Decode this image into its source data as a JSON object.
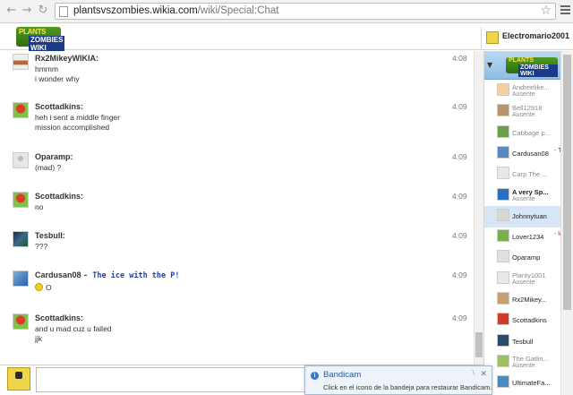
{
  "browser": {
    "url_host": "plantsvszombies.wikia.com",
    "url_path": "/wiki/Special:Chat"
  },
  "header": {
    "logo_line1": "PLANTS",
    "logo_line2": "ZOMBIES WIKI",
    "current_user": "Electromario2001"
  },
  "messages": [
    {
      "user": "Rx2MikeyWIKIA:",
      "status": "",
      "time": "4:08",
      "lines": [
        "hmmm",
        "i wonder why"
      ],
      "avatar": "rx2"
    },
    {
      "user": "Scottadkins:",
      "status": "",
      "time": "4:09",
      "lines": [
        "heh i sent a middle finger",
        "mission accomplished"
      ],
      "avatar": "scott"
    },
    {
      "user": "Oparamp:",
      "status": "",
      "time": "4:09",
      "lines": [
        "(mad) ?"
      ],
      "avatar": "opa"
    },
    {
      "user": "Scottadkins:",
      "status": "",
      "time": "4:09",
      "lines": [
        "no"
      ],
      "avatar": "scott"
    },
    {
      "user": "Tesbull:",
      "status": "",
      "time": "4:09",
      "lines": [
        "???"
      ],
      "avatar": "tes"
    },
    {
      "user": "Cardusan08",
      "status": "- The ice with the P!",
      "time": "4:09",
      "lines": [
        "O"
      ],
      "avatar": "car"
    },
    {
      "user": "Scottadkins:",
      "status": "",
      "time": "4:09",
      "lines": [
        "and u mad cuz u failed",
        "jjk"
      ],
      "avatar": "scott"
    }
  ],
  "userlist": [
    {
      "name": "Andreelike...",
      "status": "Ausente",
      "extra": "",
      "away": true
    },
    {
      "name": "Bell12918",
      "status": "Ausente",
      "extra": "",
      "away": true
    },
    {
      "name": "Cabbage p...",
      "status": "",
      "extra": "",
      "away": true
    },
    {
      "name": "Cardusan08",
      "status": "",
      "extra": "- Th",
      "away": false
    },
    {
      "name": "Carp The ...",
      "status": "",
      "extra": "",
      "away": true
    },
    {
      "name": "A very Sp...",
      "status": "Ausente",
      "extra": "",
      "away": false
    },
    {
      "name": "Johnnytuan",
      "status": "",
      "extra": "",
      "away": false
    },
    {
      "name": "Lover1234",
      "status": "",
      "extra": "- lov",
      "away": false
    },
    {
      "name": "Oparamp",
      "status": "",
      "extra": "",
      "away": false
    },
    {
      "name": "Planty1001",
      "status": "Ausente",
      "extra": "",
      "away": true
    },
    {
      "name": "Rx2Mikey...",
      "status": "",
      "extra": "",
      "away": false
    },
    {
      "name": "Scottadkins",
      "status": "",
      "extra": "",
      "away": false
    },
    {
      "name": "Tesbull",
      "status": "",
      "extra": "",
      "away": false
    },
    {
      "name": "The Gatlin...",
      "status": "Ausente",
      "extra": "",
      "away": true
    },
    {
      "name": "UltimateFa...",
      "status": "",
      "extra": "",
      "away": false
    }
  ],
  "notification": {
    "title": "Bandicam",
    "body": "Click en el icono de la bandeja para restaurar Bandicam."
  },
  "colors": {
    "status_blue": "#1a3fc2",
    "selected_row": "#d6e6f5",
    "extra_red": "#cc2222",
    "extra_blue": "#1a3fc2"
  }
}
